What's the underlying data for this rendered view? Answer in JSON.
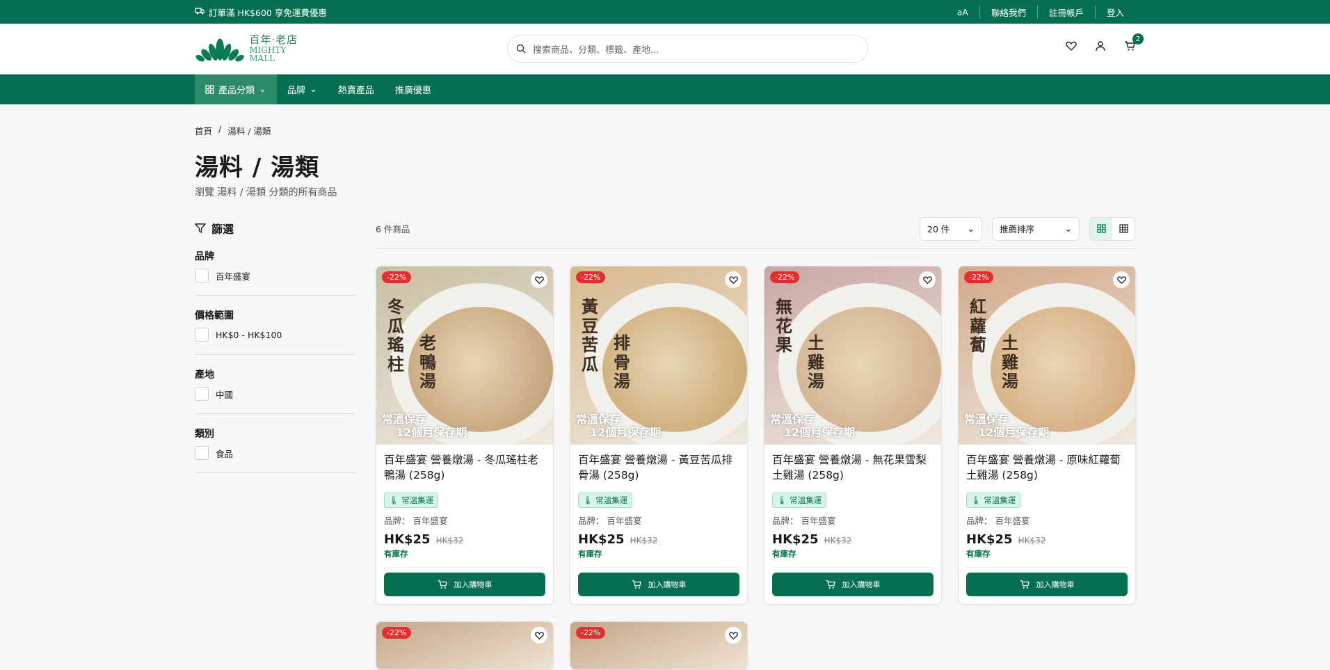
{
  "topbar": {
    "shipping": "訂單滿 HK$600 享免運費優惠",
    "font_size": "aA",
    "contact": "聯絡我們",
    "register": "註冊帳戶",
    "login": "登入"
  },
  "header": {
    "logo_cn": "百年·老店",
    "logo_en": "MIGHTY MALL",
    "search_placeholder": "搜索商品、分類、標籤、產地...",
    "cart_count": "2"
  },
  "nav": {
    "items": [
      "產品分類",
      "品牌",
      "熱賣產品",
      "推廣優惠"
    ]
  },
  "breadcrumb": {
    "home": "首頁",
    "sep": "/",
    "current": "湯料 / 湯類"
  },
  "page": {
    "title": "湯料 / 湯類",
    "subtitle": "瀏覽 湯料 / 湯類 分類的所有商品"
  },
  "filters": {
    "title": "篩選",
    "groups": [
      {
        "label": "品牌",
        "option": "百年盛宴"
      },
      {
        "label": "價格範圍",
        "option": "HK$0 - HK$100"
      },
      {
        "label": "產地",
        "option": "中國"
      },
      {
        "label": "類別",
        "option": "食品"
      }
    ]
  },
  "toolbar": {
    "count": "6 件商品",
    "per_page": "20 件",
    "sort": "推薦排序"
  },
  "products": [
    {
      "discount": "-22%",
      "name": "百年盛宴 營養燉湯 - 冬瓜瑤柱老鴨湯 (258g)",
      "img_t1": "冬瓜瑤柱",
      "img_t2": "老鴨湯",
      "tag": "常溫集運",
      "brand": "品牌： 百年盛宴",
      "price": "HK$25",
      "old_price": "HK$32",
      "stock": "有庫存",
      "cart": "加入購物車",
      "color": "#c9bfa4",
      "soup": "#b99467"
    },
    {
      "discount": "-22%",
      "name": "百年盛宴 營養燉湯 - 黃豆苦瓜排骨湯 (258g)",
      "img_t1": "黃豆苦瓜",
      "img_t2": "排骨湯",
      "tag": "常溫集運",
      "brand": "品牌： 百年盛宴",
      "price": "HK$25",
      "old_price": "HK$32",
      "stock": "有庫存",
      "cart": "加入購物車",
      "color": "#d7b98d",
      "soup": "#c49e62"
    },
    {
      "discount": "-22%",
      "name": "百年盛宴 營養燉湯 - 無花果雪梨土雞湯 (258g)",
      "img_t1": "無花果",
      "img_t2": "土雞湯",
      "tag": "常溫集運",
      "brand": "品牌： 百年盛宴",
      "price": "HK$25",
      "old_price": "HK$32",
      "stock": "有庫存",
      "cart": "加入購物車",
      "color": "#c9a7a3",
      "soup": "#c9a582"
    },
    {
      "discount": "-22%",
      "name": "百年盛宴 營養燉湯 - 原味紅蘿蔔土雞湯 (258g)",
      "img_t1": "紅蘿蔔",
      "img_t2": "土雞湯",
      "tag": "常溫集運",
      "brand": "品牌： 百年盛宴",
      "price": "HK$25",
      "old_price": "HK$32",
      "stock": "有庫存",
      "cart": "加入購物車",
      "color": "#d3a98a",
      "soup": "#cf9f6d"
    }
  ],
  "image_stamp": {
    "l1": "常溫保存",
    "l2": "12個月保存期"
  },
  "extra_discounts": [
    "-22%",
    "-22%"
  ]
}
